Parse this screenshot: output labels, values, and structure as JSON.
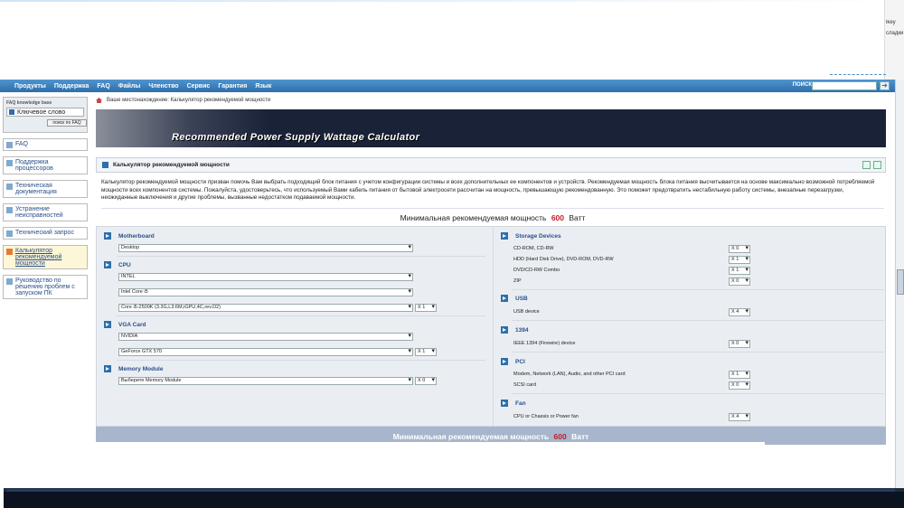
{
  "right_strip": [
    "lkey",
    "сладки"
  ],
  "nav": [
    "Продукты",
    "Поддержка",
    "FAQ",
    "Файлы",
    "Членство",
    "Сервис",
    "Гарантия",
    "Язык"
  ],
  "search_label": "ПОИСК",
  "sidebar": {
    "kw_title": "FAQ knowledge base",
    "kw_placeholder": "Ключевое слово",
    "kw_button": "поиск по FAQ",
    "items": [
      {
        "label": "FAQ"
      },
      {
        "label": "Поддержка процессоров"
      },
      {
        "label": "Техническая документация"
      },
      {
        "label": "Устранение неисправностей"
      },
      {
        "label": "Технический запрос"
      },
      {
        "label": "Калькулятор рекомендуемой мощности"
      },
      {
        "label": "Руководство по решению проблем с запуском ПК"
      }
    ]
  },
  "breadcrumb": "Ваше местонахождение: Калькулятор рекомендуемой мощности",
  "banner_title": "Recommended Power Supply Wattage Calculator",
  "section_title": "Калькулятор рекомендуемой мощности",
  "description": "Калькулятор рекомендуемой мощности призван помочь Вам выбрать подходящий блок питания с учетом конфигурации системы и всех дополнительных ее компонентов и устройств. Рекомендуемая мощность блока питания высчитывается на основе максимально возможной потребляемой мощности всех компонентов системы. Пожалуйста, удостоверьтесь, что используемый Вами кабель питания от бытовой электросети рассчитан на мощность, превышающую рекомендованную. Это поможет предотвратить нестабильную работу системы, внезапные перезагрузки, неожиданные выключения и другие проблемы, вызванные недостатком подаваемой мощности.",
  "result": {
    "label": "Минимальная рекомендуемая мощность",
    "value": "600",
    "unit": "Ватт"
  },
  "left_groups": {
    "motherboard": {
      "title": "Motherboard",
      "select": "Desktop"
    },
    "cpu": {
      "title": "CPU",
      "brand": "INTEL",
      "family": "Intel Core i5",
      "model": "Core i5-2500K (3.3G,L3:6M,iGPU,4C,rev.D2)",
      "qty": "X 1"
    },
    "vga": {
      "title": "VGA Card",
      "brand": "NVIDIA",
      "model": "GeForce GTX 570",
      "qty": "X 1"
    },
    "memory": {
      "title": "Memory Module",
      "select": "Выберите Memory Module",
      "qty": "X 0"
    }
  },
  "right_groups": {
    "storage": {
      "title": "Storage Devices",
      "rows": [
        {
          "name": "CD-ROM, CD-RW",
          "qty": "X 0"
        },
        {
          "name": "HDD (Hard Disk Drive), DVD-ROM, DVD-RW",
          "qty": "X 1"
        },
        {
          "name": "DVD/CD-RW Combo",
          "qty": "X 1"
        },
        {
          "name": "ZIP",
          "qty": "X 0"
        }
      ]
    },
    "usb": {
      "title": "USB",
      "rows": [
        {
          "name": "USB device",
          "qty": "X 4"
        }
      ]
    },
    "ieee": {
      "title": "1394",
      "rows": [
        {
          "name": "IEEE 1394 (Firewire) device",
          "qty": "X 0"
        }
      ]
    },
    "pci": {
      "title": "PCI",
      "rows": [
        {
          "name": "Modem, Network (LAN), Audio, and other PCI card",
          "qty": "X 1"
        },
        {
          "name": "SCSI card",
          "qty": "X 0"
        }
      ]
    },
    "fan": {
      "title": "Fan",
      "rows": [
        {
          "name": "CPU or Chassis or Power fan",
          "qty": "X 4"
        }
      ]
    }
  },
  "colors": {
    "nav_blue": "#2d6faa",
    "accent_red": "#c0202a",
    "panel_bg": "#eaeef3",
    "banner_dark": "#1a2238"
  }
}
